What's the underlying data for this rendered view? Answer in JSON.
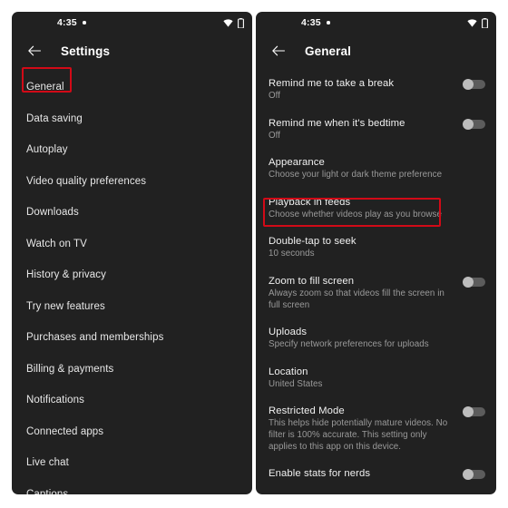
{
  "status_bar": {
    "time": "4:35",
    "dot_indicator": "•",
    "wifi_icon": "wifi-icon",
    "battery_icon": "battery-icon"
  },
  "colors": {
    "panel_background": "#212121",
    "page_background": "#ffffff",
    "primary_text": "#f1f1f1",
    "secondary_text": "#9a9a9a",
    "annotation_red": "#d20a17",
    "toggle_track_off": "#5c5c5c",
    "toggle_knob_off": "#bdbdbd"
  },
  "left_panel": {
    "app_bar": {
      "back_icon": "back-arrow-icon",
      "title": "Settings"
    },
    "items": [
      {
        "label": "General",
        "highlighted": true
      },
      {
        "label": "Data saving",
        "highlighted": false
      },
      {
        "label": "Autoplay",
        "highlighted": false
      },
      {
        "label": "Video quality preferences",
        "highlighted": false
      },
      {
        "label": "Downloads",
        "highlighted": false
      },
      {
        "label": "Watch on TV",
        "highlighted": false
      },
      {
        "label": "History & privacy",
        "highlighted": false
      },
      {
        "label": "Try new features",
        "highlighted": false
      },
      {
        "label": "Purchases and memberships",
        "highlighted": false
      },
      {
        "label": "Billing & payments",
        "highlighted": false
      },
      {
        "label": "Notifications",
        "highlighted": false
      },
      {
        "label": "Connected apps",
        "highlighted": false
      },
      {
        "label": "Live chat",
        "highlighted": false
      },
      {
        "label": "Captions",
        "highlighted": false
      }
    ]
  },
  "right_panel": {
    "app_bar": {
      "back_icon": "back-arrow-icon",
      "title": "General"
    },
    "settings": [
      {
        "title": "Remind me to take a break",
        "subtitle": "Off",
        "toggle": "off",
        "highlighted": false
      },
      {
        "title": "Remind me when it's bedtime",
        "subtitle": "Off",
        "toggle": "off",
        "highlighted": false
      },
      {
        "title": "Appearance",
        "subtitle": "Choose your light or dark theme preference",
        "toggle": null,
        "highlighted": false
      },
      {
        "title": "Playback in feeds",
        "subtitle": "Choose whether videos play as you browse",
        "toggle": null,
        "highlighted": true
      },
      {
        "title": "Double-tap to seek",
        "subtitle": "10 seconds",
        "toggle": null,
        "highlighted": false
      },
      {
        "title": "Zoom to fill screen",
        "subtitle": "Always zoom so that videos fill the screen in full screen",
        "toggle": "off",
        "highlighted": false
      },
      {
        "title": "Uploads",
        "subtitle": "Specify network preferences for uploads",
        "toggle": null,
        "highlighted": false
      },
      {
        "title": "Location",
        "subtitle": "United States",
        "toggle": null,
        "highlighted": false
      },
      {
        "title": "Restricted Mode",
        "subtitle": "This helps hide potentially mature videos. No filter is 100% accurate. This setting only applies to this app on this device.",
        "toggle": "off",
        "highlighted": false
      },
      {
        "title": "Enable stats for nerds",
        "subtitle": "",
        "toggle": "off",
        "highlighted": false
      }
    ]
  }
}
